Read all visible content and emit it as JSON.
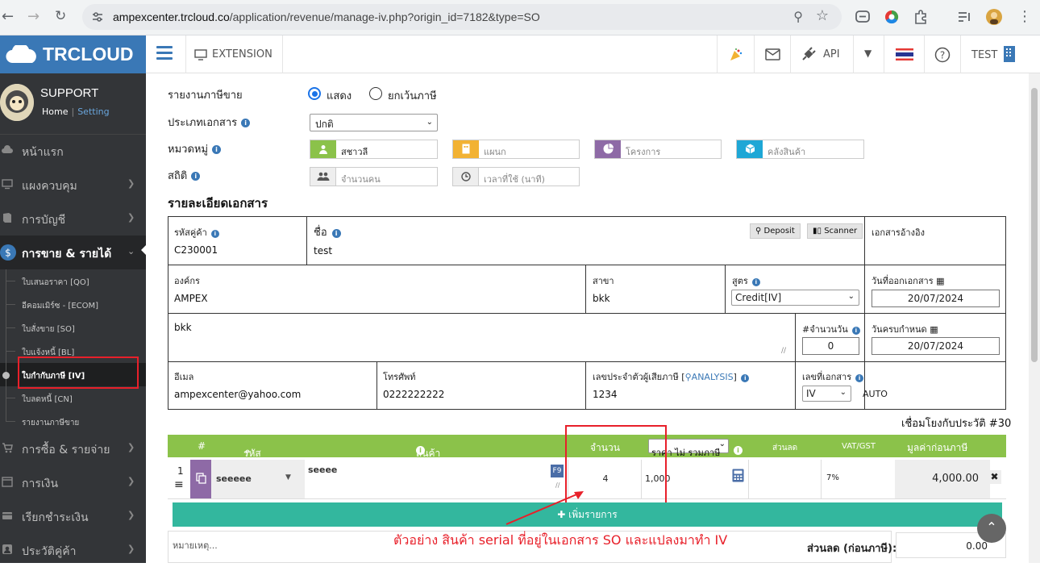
{
  "browser": {
    "url_host": "ampexcenter.trcloud.co",
    "url_path": "/application/revenue/manage-iv.php?origin_id=7182&type=SO"
  },
  "topbar": {
    "brand": "TRCLOUD",
    "extension_label": "EXTENSION",
    "api_label": "API",
    "user_label": "TEST"
  },
  "profile": {
    "name": "SUPPORT",
    "home": "Home",
    "setting": "Setting"
  },
  "sidebar": {
    "items": [
      {
        "label": "หน้าแรก",
        "icon": "cloud-icon"
      },
      {
        "label": "แผงควบคุม",
        "icon": "monitor-icon"
      },
      {
        "label": "การบัญชี",
        "icon": "book-icon"
      },
      {
        "label": "การขาย & รายได้",
        "icon": "dollar-icon"
      },
      {
        "label": "การซื้อ & รายจ่าย",
        "icon": "cart-icon"
      },
      {
        "label": "การเงิน",
        "icon": "calendar-icon"
      },
      {
        "label": "เรียกชำระเงิน",
        "icon": "card-icon"
      },
      {
        "label": "ประวัติคู่ค้า",
        "icon": "user-icon"
      }
    ],
    "subitems": [
      "ใบเสนอราคา [QO]",
      "อีคอมเมิร์ซ - [ECOM]",
      "ใบสั่งขาย [SO]",
      "ใบแจ้งหนี้ [BL]",
      "ใบกำกับภาษี [IV]",
      "ใบลดหนี้ [CN]",
      "รายงานภาษีขาย"
    ]
  },
  "form": {
    "tax_report_label": "รายงานภาษีขาย",
    "radio_show": "แสดง",
    "radio_exclude": "ยกเว้นภาษี",
    "doc_type_label": "ประเภทเอกสาร",
    "doc_type_value": "ปกติ",
    "category_label": "หมวดหมู่",
    "category_value": "สชาวลี",
    "department_placeholder": "แผนก",
    "project_placeholder": "โครงการ",
    "warehouse_placeholder": "คลังสินค้า",
    "stat_label": "สถิติ",
    "people_placeholder": "จำนวนคน",
    "time_placeholder": "เวลาที่ใช้ (นาที)"
  },
  "details": {
    "section_title": "รายละเอียดเอกสาร",
    "customer_code_label": "รหัสคู่ค้า",
    "customer_code": "C230001",
    "name_label": "ชื่อ",
    "name_value": "test",
    "deposit_btn": "Deposit",
    "scanner_btn": "Scanner",
    "ref_doc_label": "เอกสารอ้างอิง",
    "org_label": "องค์กร",
    "org_value": "AMPEX",
    "branch_label": "สาขา",
    "branch_value": "bkk",
    "formula_label": "สูตร",
    "formula_value": "Credit[IV]",
    "issue_date_label": "วันที่ออกเอกสาร",
    "issue_date": "20/07/2024",
    "address_value": "bkk",
    "days_label": "#จำนวนวัน",
    "days_value": "0",
    "due_date_label": "วันครบกำหนด",
    "due_date": "20/07/2024",
    "email_label": "อีเมล",
    "email_value": "ampexcenter@yahoo.com",
    "phone_label": "โทรศัพท์",
    "phone_value": "0222222222",
    "tax_id_label": "เลขประจำตัวผู้เสียภาษี",
    "analysis": "ANALYSIS",
    "tax_id_value": "1234",
    "doc_no_label": "เลขที่เอกสาร",
    "doc_no_prefix": "IV",
    "doc_no_auto": "AUTO",
    "history_link": "เชื่อมโยงกับประวัติ #30"
  },
  "grid": {
    "headers": {
      "num": "#",
      "code": "รหัส",
      "product": "สินค้า",
      "qty": "จำนวน",
      "price_select": "ราคา ไม่ รวมภาษี",
      "discount": "ส่วนลด",
      "vat": "VAT/GST",
      "amount": "มูลค่าก่อนภาษี"
    },
    "row": {
      "index": "1",
      "code": "seeeee",
      "desc": "seeee",
      "f9": "F9",
      "qty": "4",
      "price": "1,000",
      "vat": "7%",
      "amount": "4,000.00"
    },
    "add_row": "เพิ่มรายการ"
  },
  "footer": {
    "note_placeholder": "หมายเหตุ...",
    "discount_label": "ส่วนลด (ก่อนภาษี):",
    "discount_value": "0.00"
  },
  "annotation": "ตัวอย่าง สินค้า serial ที่อยู่ในเอกสาร SO และแปลงมาทำ IV",
  "colors": {
    "brand": "#3a78b6",
    "sidebar": "#333538",
    "grid_header": "#8bc24a",
    "add_button": "#33b79e",
    "highlight": "#e8202a"
  }
}
